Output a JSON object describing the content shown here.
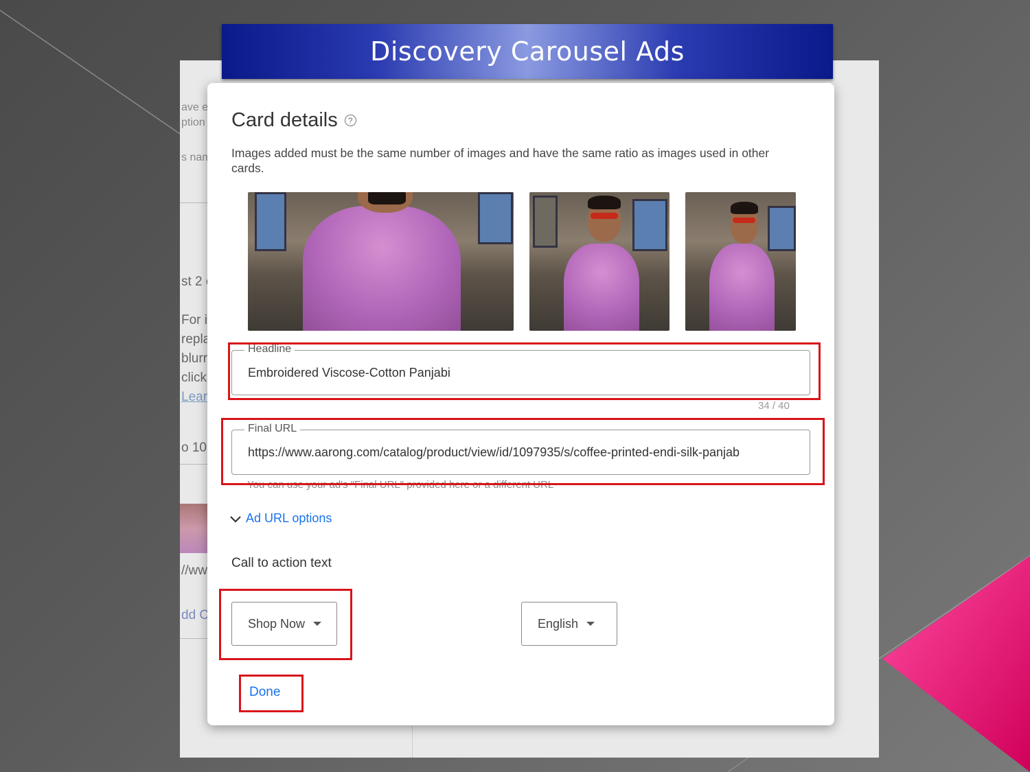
{
  "slide": {
    "title": "Discovery Carousel Ads",
    "accent_color": "#e8106a"
  },
  "background_fragments": {
    "lines": [
      "ave e",
      "ption",
      "s nam",
      "st 2 c",
      "For i",
      "repla",
      "blurr",
      "click",
      "Lear",
      "o 10 c",
      "//www",
      "dd C"
    ]
  },
  "modal": {
    "title": "Card details",
    "help_icon": "help-circle-icon",
    "description": "Images added must be the same number of images and have the same ratio as images used in other cards.",
    "headline": {
      "label": "Headline",
      "value": "Embroidered Viscose-Cotton Panjabi",
      "counter": "34 / 40"
    },
    "final_url": {
      "label": "Final URL",
      "value": "https://www.aarong.com/catalog/product/view/id/1097935/s/coffee-printed-endi-silk-panjab",
      "helper": "You can use your ad's \"Final URL\" provided here or a different URL"
    },
    "ad_url_options": "Ad URL options",
    "cta_label": "Call to action text",
    "cta_select": "Shop Now",
    "language_select": "English",
    "done": "Done"
  }
}
